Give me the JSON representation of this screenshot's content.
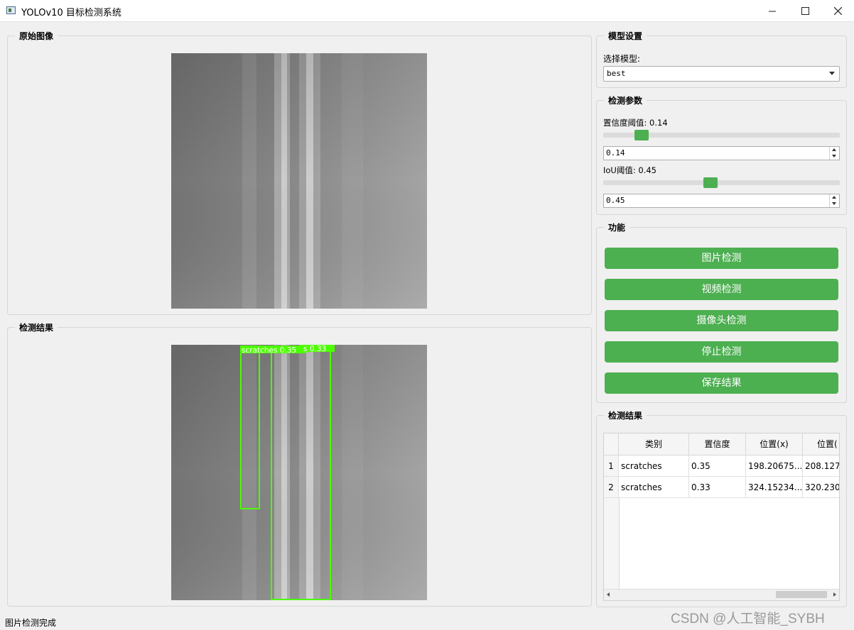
{
  "window": {
    "title": "YOLOv10 目标检测系统"
  },
  "original_panel": {
    "title": "原始图像"
  },
  "result_panel": {
    "title": "检测结果",
    "detections": [
      {
        "label": "scratches 0.35"
      },
      {
        "label": "s 0.33"
      }
    ]
  },
  "model_settings": {
    "title": "模型设置",
    "select_label": "选择模型:",
    "selected_model": "best"
  },
  "detection_params": {
    "title": "检测参数",
    "confidence_label": "置信度阈值: 0.14",
    "confidence_value": "0.14",
    "confidence_fraction": 0.14,
    "iou_label": "IoU阈值: 0.45",
    "iou_value": "0.45",
    "iou_fraction": 0.45
  },
  "functions": {
    "title": "功能",
    "buttons": [
      "图片检测",
      "视频检测",
      "摄像头检测",
      "停止检测",
      "保存结果"
    ]
  },
  "results_table": {
    "title": "检测结果",
    "headers": [
      "类别",
      "置信度",
      "位置(x)",
      "位置("
    ],
    "rows": [
      {
        "index": "1",
        "cells": [
          "scratches",
          "0.35",
          "198.20675...",
          "208.127"
        ]
      },
      {
        "index": "2",
        "cells": [
          "scratches",
          "0.33",
          "324.15234...",
          "320.230"
        ]
      }
    ]
  },
  "status_bar": {
    "text": "图片检测完成"
  },
  "watermark": "CSDN @人工智能_SYBH",
  "colors": {
    "accent": "#4caf50",
    "detection_box": "#4cff00"
  }
}
